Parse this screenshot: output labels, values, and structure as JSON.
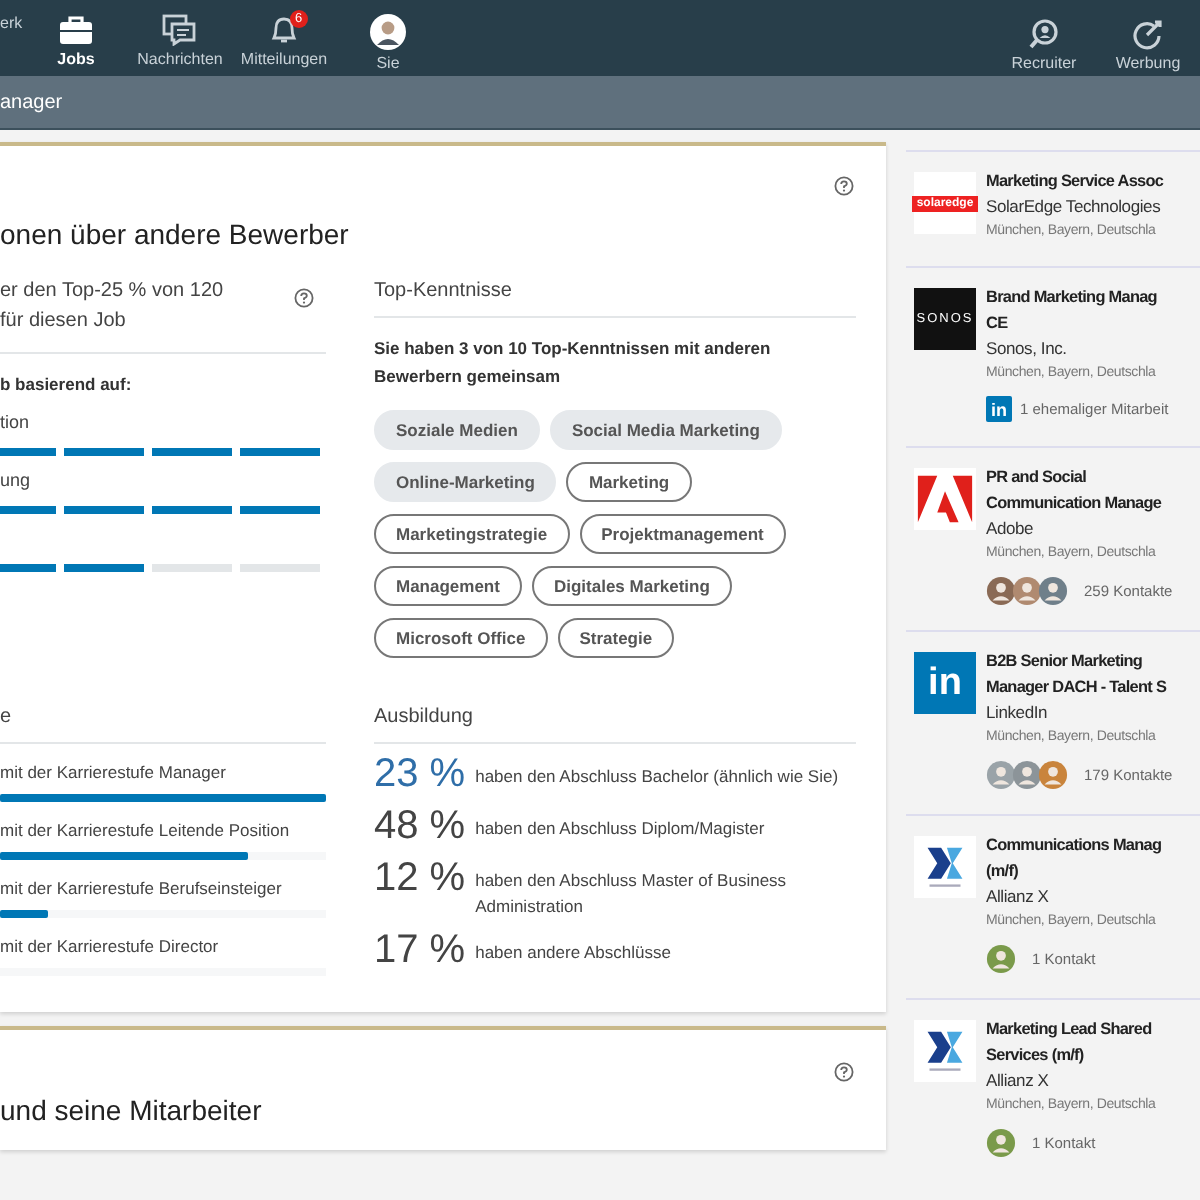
{
  "nav": {
    "items": [
      {
        "label": "erk",
        "selected": false
      },
      {
        "label": "Jobs",
        "selected": true
      },
      {
        "label": "Nachrichten",
        "selected": false
      },
      {
        "label": "Mitteilungen",
        "selected": false,
        "badge": "6"
      },
      {
        "label": "Sie",
        "selected": false
      }
    ],
    "right_items": [
      {
        "label": "Recruiter"
      },
      {
        "label": "Werbung"
      }
    ]
  },
  "subbar": {
    "title": "anager"
  },
  "insights": {
    "title": "onen über andere Bewerber",
    "rank_lines": [
      "er den Top-25 % von 120",
      "für diesen Job"
    ],
    "basis": "b basierend auf:",
    "criteria": [
      {
        "label": "tion",
        "level": 1
      },
      {
        "label": "ung",
        "level": 1
      },
      {
        "level": 0.45
      }
    ],
    "skills_title": "Top-Kenntnisse",
    "skills_summary": "Sie haben 3 von 10 Top-Kenntnissen mit anderen Bewerbern gemeinsam",
    "skills": [
      {
        "label": "Soziale Medien",
        "shared": true
      },
      {
        "label": "Social Media Marketing",
        "shared": true
      },
      {
        "label": "Online-Marketing",
        "shared": true
      },
      {
        "label": "Marketing",
        "shared": false
      },
      {
        "label": "Marketingstrategie",
        "shared": false
      },
      {
        "label": "Projektmanagement",
        "shared": false
      },
      {
        "label": "Management",
        "shared": false
      },
      {
        "label": "Digitales Marketing",
        "shared": false
      },
      {
        "label": "Microsoft Office",
        "shared": false
      },
      {
        "label": "Strategie",
        "shared": false
      }
    ],
    "career_title": "e",
    "careers": [
      {
        "label": "mit der Karrierestufe Manager",
        "level": 1
      },
      {
        "label": "mit der Karrierestufe Leitende Position",
        "level": 0.76
      },
      {
        "label": "mit der Karrierestufe Berufseinsteiger",
        "level": 0.15
      },
      {
        "label": "mit der Karrierestufe Director"
      }
    ],
    "education_title": "Ausbildung",
    "education": [
      {
        "percent": "23 %",
        "text": "haben den Abschluss Bachelor (ähnlich wie Sie)",
        "highlighted": true
      },
      {
        "percent": "48 %",
        "text": "haben den Abschluss Diplom/Magister",
        "highlighted": false
      },
      {
        "percent": "12 %",
        "text": "haben den Abschluss Master of Business Administration",
        "highlighted": false
      },
      {
        "percent": "17 %",
        "text": "haben andere Abschlüsse",
        "highlighted": false
      }
    ]
  },
  "next_section": {
    "title": "und seine Mitarbeiter"
  },
  "jobs": [
    {
      "logo_text": "solaredge",
      "title_lines": [
        "Marketing Service Assoc"
      ],
      "company": "SolarEdge Technologies",
      "location": "München, Bayern, Deutschla"
    },
    {
      "logo_text": "SONOS",
      "title_lines": [
        "Brand Marketing Manag",
        "CE"
      ],
      "company": "Sonos, Inc.",
      "location": "München, Bayern, Deutschla",
      "network": {
        "kind": "alumni",
        "badge": "in",
        "text": "1 ehemaliger Mitarbeit"
      }
    },
    {
      "title_lines": [
        "PR and Social",
        "Communication Manage"
      ],
      "company": "Adobe",
      "location": "München, Bayern, Deutschla",
      "network": {
        "kind": "contacts",
        "people": [
          {
            "color": "#8a6a55"
          },
          {
            "color": "#b08a70"
          },
          {
            "color": "#6f7f8a"
          }
        ],
        "text": "259 Kontakte"
      }
    },
    {
      "logo_text": "in",
      "title_lines": [
        "B2B Senior Marketing",
        "Manager DACH - Talent S"
      ],
      "company": "LinkedIn",
      "location": "München, Bayern, Deutschla",
      "network": {
        "kind": "contacts",
        "people": [
          {
            "color": "#9aa3a8"
          },
          {
            "color": "#8c9499"
          },
          {
            "color": "#c9843c"
          }
        ],
        "text": "179 Kontakte"
      }
    },
    {
      "title_lines": [
        "Communications Manag",
        "(m/f)"
      ],
      "company": "Allianz X",
      "location": "München, Bayern, Deutschla",
      "network": {
        "kind": "contacts",
        "people": [
          {
            "color": "#7a9a4a"
          }
        ],
        "text": "1 Kontakt"
      }
    },
    {
      "title_lines": [
        "Marketing Lead Shared",
        "Services (m/f)"
      ],
      "company": "Allianz X",
      "location": "München, Bayern, Deutschla",
      "network": {
        "kind": "contacts",
        "people": [
          {
            "color": "#7a9a4a"
          }
        ],
        "text": "1 Kontakt"
      }
    }
  ]
}
